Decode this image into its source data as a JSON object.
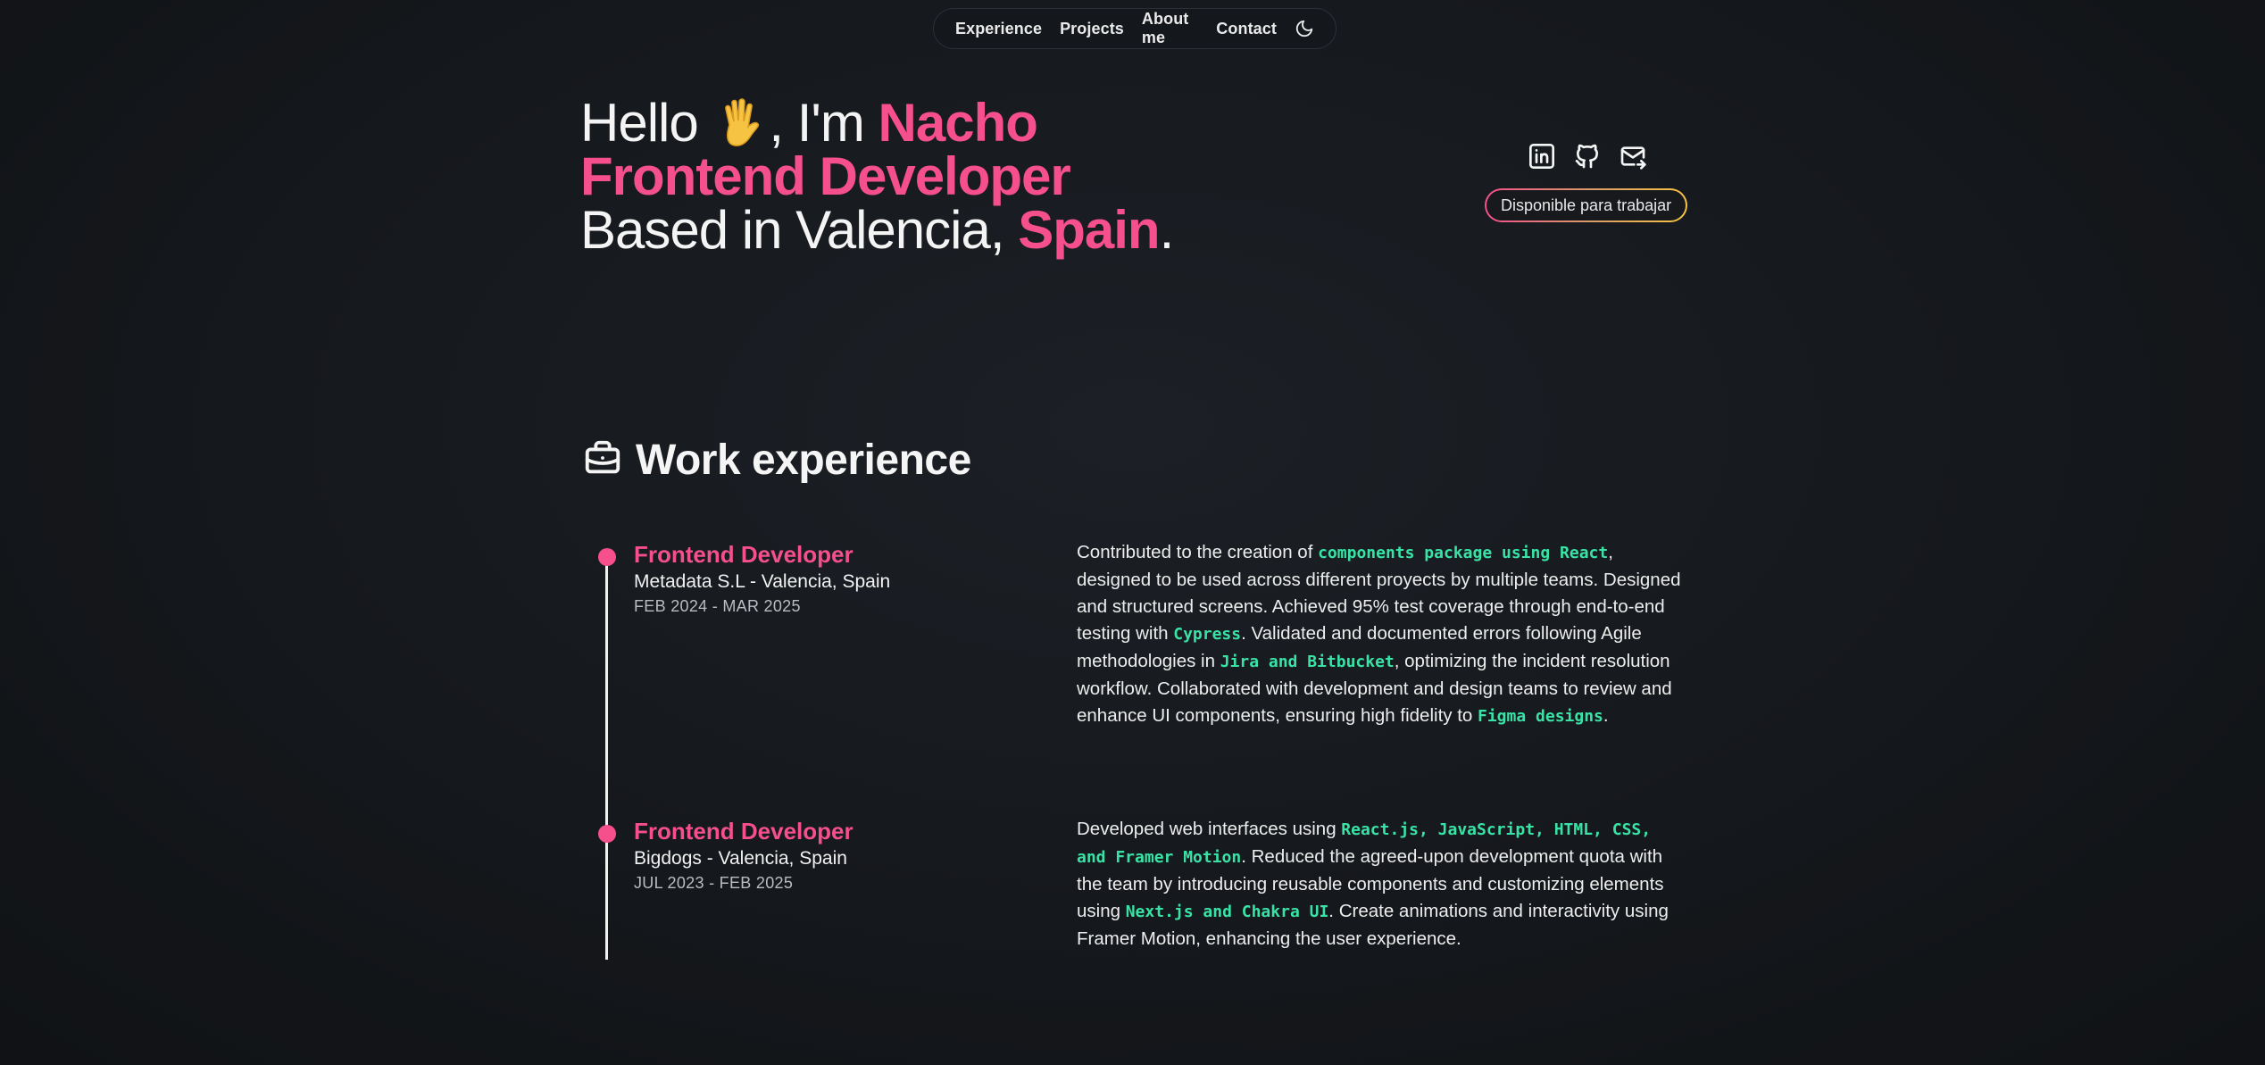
{
  "nav": {
    "items": [
      "Experience",
      "Projects",
      "About me",
      "Contact"
    ],
    "theme_icon": "moon-icon"
  },
  "hero": {
    "line1_prefix": "Hello ",
    "line1_mid": ", I'm ",
    "line1_name": "Nacho",
    "line2": "Frontend Developer",
    "line3_prefix": "Based in Valencia, ",
    "line3_country": "Spain",
    "line3_suffix": ".",
    "emoji_icon": "waving-hand-icon"
  },
  "social": {
    "icons": [
      "linkedin-icon",
      "github-icon",
      "mail-icon"
    ]
  },
  "badge": {
    "label": "Disponible para trabajar"
  },
  "section": {
    "title": "Work experience",
    "icon": "briefcase-icon"
  },
  "jobs": [
    {
      "title": "Frontend Developer",
      "company": "Metadata S.L - Valencia, Spain",
      "date": "FEB 2024 - MAR 2025",
      "desc": [
        {
          "t": "Contributed to the creation of ",
          "hl": false
        },
        {
          "t": "components package using React",
          "hl": true
        },
        {
          "t": ", designed to be used across different proyects by multiple teams. Designed and structured screens. Achieved 95% test coverage through end-to-end testing with ",
          "hl": false
        },
        {
          "t": "Cypress",
          "hl": true
        },
        {
          "t": ". Validated and documented errors following Agile methodologies in ",
          "hl": false
        },
        {
          "t": "Jira and Bitbucket",
          "hl": true
        },
        {
          "t": ", optimizing the incident resolution workflow. Collaborated with development and design teams to review and enhance UI components, ensuring high fidelity to ",
          "hl": false
        },
        {
          "t": "Figma designs",
          "hl": true
        },
        {
          "t": ".",
          "hl": false
        }
      ]
    },
    {
      "title": "Frontend Developer",
      "company": "Bigdogs - Valencia, Spain",
      "date": "JUL 2023 - FEB 2025",
      "desc": [
        {
          "t": "Developed web interfaces using ",
          "hl": false
        },
        {
          "t": "React.js, JavaScript, HTML, CSS, and Framer Motion",
          "hl": true
        },
        {
          "t": ". Reduced the agreed-upon development quota with the team by introducing reusable components and customizing elements using ",
          "hl": false
        },
        {
          "t": "Next.js and Chakra UI",
          "hl": true
        },
        {
          "t": ". Create animations and interactivity using Framer Motion, enhancing the user experience.",
          "hl": false
        }
      ]
    }
  ],
  "colors": {
    "accent": "#f54f8c",
    "code_highlight": "#39e3a6",
    "background": "#15181c"
  }
}
